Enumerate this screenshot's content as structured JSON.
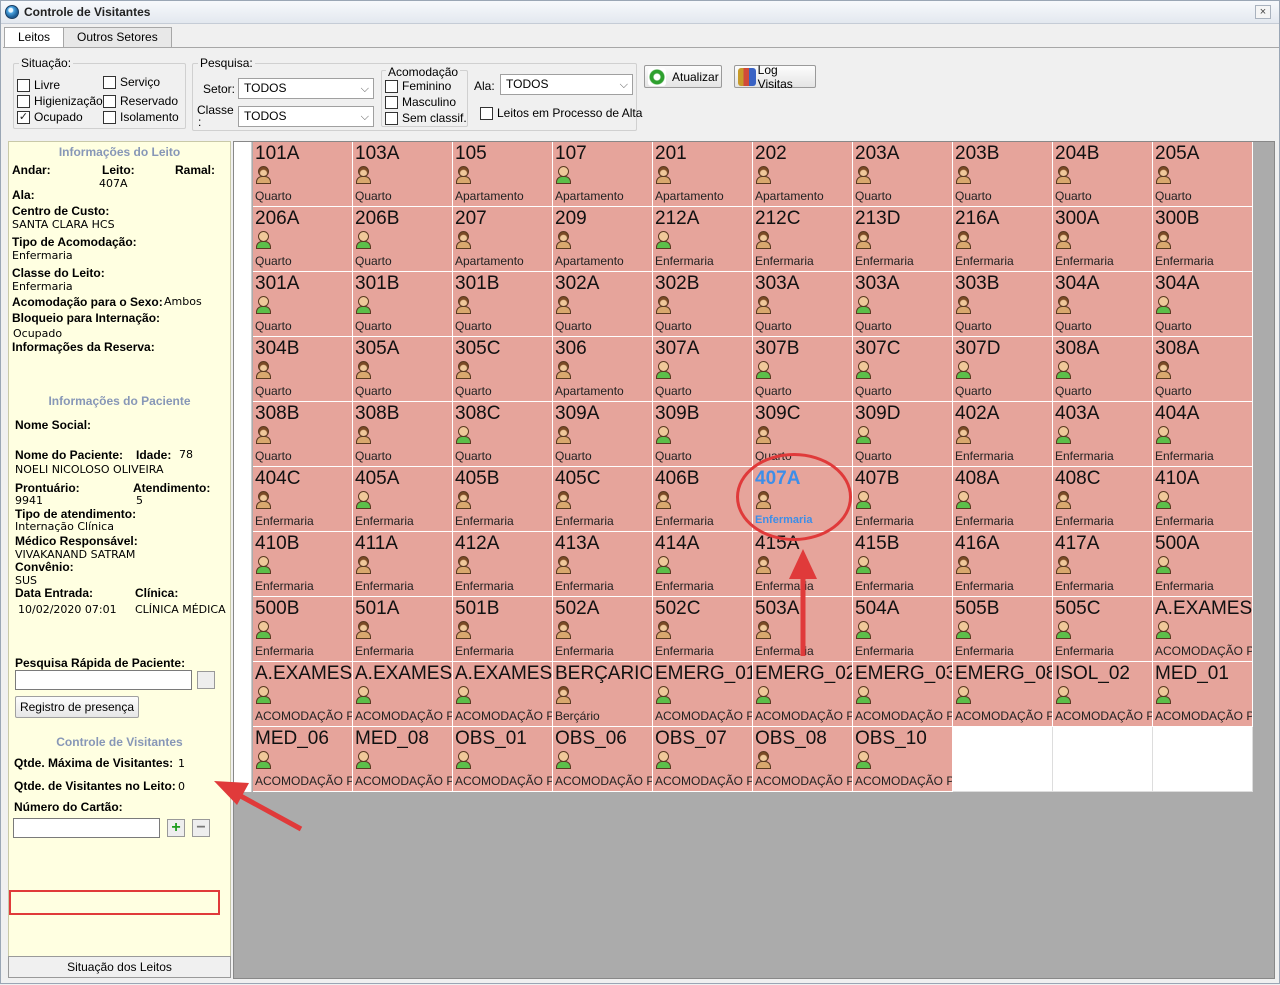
{
  "window": {
    "title": "Controle de Visitantes",
    "close_label": "×"
  },
  "tabs": [
    {
      "label": "Leitos",
      "active": true
    },
    {
      "label": "Outros Setores",
      "active": false
    }
  ],
  "situacao": {
    "legend": "Situação:",
    "options": [
      {
        "label": "Livre",
        "checked": false
      },
      {
        "label": "Serviço",
        "checked": false
      },
      {
        "label": "Higienização",
        "checked": false
      },
      {
        "label": "Reservado",
        "checked": false
      },
      {
        "label": "Ocupado",
        "checked": true
      },
      {
        "label": "Isolamento",
        "checked": false
      }
    ]
  },
  "pesquisa": {
    "legend": "Pesquisa:",
    "setor_label": "Setor:",
    "setor_value": "TODOS",
    "classe_label": "Classe",
    "classe_label2": ":",
    "classe_value": "TODOS"
  },
  "acomodacao": {
    "legend": "Acomodação",
    "options": [
      {
        "label": "Feminino",
        "checked": false
      },
      {
        "label": "Masculino",
        "checked": false
      },
      {
        "label": "Sem classif.",
        "checked": false
      }
    ]
  },
  "ala": {
    "label": "Ala:",
    "value": "TODOS"
  },
  "processo_alta": {
    "label": "Leitos em Processo de Alta",
    "checked": false
  },
  "toolbar": {
    "atualizar_label": "Atualizar",
    "log_label": "Log Visitas"
  },
  "leito_info": {
    "heading": "Informações do Leito",
    "andar_label": "Andar:",
    "leito_label": "Leito:",
    "leito_value": "407A",
    "ramal_label": "Ramal:",
    "ala_label": "Ala:",
    "centro_custo_label": "Centro de Custo:",
    "centro_custo_value": "SANTA CLARA HCS",
    "tipo_acomodacao_label": "Tipo de Acomodação:",
    "tipo_acomodacao_value": "Enfermaria",
    "classe_leito_label": "Classe do Leito:",
    "classe_leito_value": "Enfermaria",
    "sexo_label": "Acomodação para o Sexo:",
    "sexo_value": "Ambos",
    "bloqueio_label": "Bloqueio para Internação:",
    "bloqueio_value": "Ocupado",
    "reserva_label": "Informações da Reserva:"
  },
  "paciente_info": {
    "heading": "Informações do Paciente",
    "nome_social_label": "Nome Social:",
    "nome_label": "Nome do Paciente:",
    "idade_label": "Idade:",
    "idade_value": "78",
    "nome_value": "NOELI NICOLOSO OLIVEIRA",
    "prontuario_label": "Prontuário:",
    "prontuario_value": "9941",
    "atendimento_label": "Atendimento:",
    "atendimento_value": "5",
    "tipo_atendimento_label": "Tipo de atendimento:",
    "tipo_atendimento_value": "Internação Clínica",
    "medico_label": "Médico Responsável:",
    "medico_value": "VIVAKANAND SATRAM",
    "convenio_label": "Convênio:",
    "convenio_value": "SUS",
    "data_entrada_label": "Data Entrada:",
    "data_entrada_value": "10/02/2020 07:01",
    "clinica_label": "Clínica:",
    "clinica_value": "CLÍNICA MÉDICA"
  },
  "pesquisa_rapida": {
    "label": "Pesquisa Rápida de Paciente:",
    "button_label": "Registro de presença"
  },
  "visitantes": {
    "heading": "Controle de Visitantes",
    "max_label": "Qtde. Máxima de Visitantes:",
    "max_value": "1",
    "no_leito_label": "Qtde. de Visitantes no Leito:",
    "no_leito_value": "0",
    "cartao_label": "Número do Cartão:"
  },
  "status_button": "Situação dos Leitos",
  "beds": [
    {
      "n": "101A",
      "t": "Quarto",
      "g": "f"
    },
    {
      "n": "103A",
      "t": "Quarto",
      "g": "f"
    },
    {
      "n": "105",
      "t": "Apartamento",
      "g": "f"
    },
    {
      "n": "107",
      "t": "Apartamento",
      "g": "m"
    },
    {
      "n": "201",
      "t": "Apartamento",
      "g": "f"
    },
    {
      "n": "202",
      "t": "Apartamento",
      "g": "f"
    },
    {
      "n": "203A",
      "t": "Quarto",
      "g": "f"
    },
    {
      "n": "203B",
      "t": "Quarto",
      "g": "f"
    },
    {
      "n": "204B",
      "t": "Quarto",
      "g": "f"
    },
    {
      "n": "205A",
      "t": "Quarto",
      "g": "f"
    },
    {
      "n": "206A",
      "t": "Quarto",
      "g": "m"
    },
    {
      "n": "206B",
      "t": "Quarto",
      "g": "m"
    },
    {
      "n": "207",
      "t": "Apartamento",
      "g": "f"
    },
    {
      "n": "209",
      "t": "Apartamento",
      "g": "f"
    },
    {
      "n": "212A",
      "t": "Enfermaria",
      "g": "m"
    },
    {
      "n": "212C",
      "t": "Enfermaria",
      "g": "f"
    },
    {
      "n": "213D",
      "t": "Enfermaria",
      "g": "f"
    },
    {
      "n": "216A",
      "t": "Enfermaria",
      "g": "f"
    },
    {
      "n": "300A",
      "t": "Enfermaria",
      "g": "f"
    },
    {
      "n": "300B",
      "t": "Enfermaria",
      "g": "f"
    },
    {
      "n": "301A",
      "t": "Quarto",
      "g": "m"
    },
    {
      "n": "301B",
      "t": "Quarto",
      "g": "m"
    },
    {
      "n": "301B",
      "t": "Quarto",
      "g": "f"
    },
    {
      "n": "302A",
      "t": "Quarto",
      "g": "f"
    },
    {
      "n": "302B",
      "t": "Quarto",
      "g": "f"
    },
    {
      "n": "303A",
      "t": "Quarto",
      "g": "f"
    },
    {
      "n": "303A",
      "t": "Quarto",
      "g": "m"
    },
    {
      "n": "303B",
      "t": "Quarto",
      "g": "f"
    },
    {
      "n": "304A",
      "t": "Quarto",
      "g": "f"
    },
    {
      "n": "304A",
      "t": "Quarto",
      "g": "m"
    },
    {
      "n": "304B",
      "t": "Quarto",
      "g": "f"
    },
    {
      "n": "305A",
      "t": "Quarto",
      "g": "f"
    },
    {
      "n": "305C",
      "t": "Quarto",
      "g": "f"
    },
    {
      "n": "306",
      "t": "Apartamento",
      "g": "f"
    },
    {
      "n": "307A",
      "t": "Quarto",
      "g": "m"
    },
    {
      "n": "307B",
      "t": "Quarto",
      "g": "m"
    },
    {
      "n": "307C",
      "t": "Quarto",
      "g": "m"
    },
    {
      "n": "307D",
      "t": "Quarto",
      "g": "m"
    },
    {
      "n": "308A",
      "t": "Quarto",
      "g": "m"
    },
    {
      "n": "308A",
      "t": "Quarto",
      "g": "f"
    },
    {
      "n": "308B",
      "t": "Quarto",
      "g": "f"
    },
    {
      "n": "308B",
      "t": "Quarto",
      "g": "f"
    },
    {
      "n": "308C",
      "t": "Quarto",
      "g": "m"
    },
    {
      "n": "309A",
      "t": "Quarto",
      "g": "f"
    },
    {
      "n": "309B",
      "t": "Quarto",
      "g": "m"
    },
    {
      "n": "309C",
      "t": "Quarto",
      "g": "f"
    },
    {
      "n": "309D",
      "t": "Quarto",
      "g": "m"
    },
    {
      "n": "402A",
      "t": "Enfermaria",
      "g": "f"
    },
    {
      "n": "403A",
      "t": "Enfermaria",
      "g": "m"
    },
    {
      "n": "404A",
      "t": "Enfermaria",
      "g": "m"
    },
    {
      "n": "404C",
      "t": "Enfermaria",
      "g": "f"
    },
    {
      "n": "405A",
      "t": "Enfermaria",
      "g": "m"
    },
    {
      "n": "405B",
      "t": "Enfermaria",
      "g": "f"
    },
    {
      "n": "405C",
      "t": "Enfermaria",
      "g": "f"
    },
    {
      "n": "406B",
      "t": "Enfermaria",
      "g": "f"
    },
    {
      "n": "407A",
      "t": "Enfermaria",
      "g": "f",
      "sel": true
    },
    {
      "n": "407B",
      "t": "Enfermaria",
      "g": "m"
    },
    {
      "n": "408A",
      "t": "Enfermaria",
      "g": "m"
    },
    {
      "n": "408C",
      "t": "Enfermaria",
      "g": "f"
    },
    {
      "n": "410A",
      "t": "Enfermaria",
      "g": "m"
    },
    {
      "n": "410B",
      "t": "Enfermaria",
      "g": "m"
    },
    {
      "n": "411A",
      "t": "Enfermaria",
      "g": "f"
    },
    {
      "n": "412A",
      "t": "Enfermaria",
      "g": "f"
    },
    {
      "n": "413A",
      "t": "Enfermaria",
      "g": "f"
    },
    {
      "n": "414A",
      "t": "Enfermaria",
      "g": "m"
    },
    {
      "n": "415A",
      "t": "Enfermaria",
      "g": "f"
    },
    {
      "n": "415B",
      "t": "Enfermaria",
      "g": "m"
    },
    {
      "n": "416A",
      "t": "Enfermaria",
      "g": "f"
    },
    {
      "n": "417A",
      "t": "Enfermaria",
      "g": "f"
    },
    {
      "n": "500A",
      "t": "Enfermaria",
      "g": "m"
    },
    {
      "n": "500B",
      "t": "Enfermaria",
      "g": "m"
    },
    {
      "n": "501A",
      "t": "Enfermaria",
      "g": "f"
    },
    {
      "n": "501B",
      "t": "Enfermaria",
      "g": "f"
    },
    {
      "n": "502A",
      "t": "Enfermaria",
      "g": "f"
    },
    {
      "n": "502C",
      "t": "Enfermaria",
      "g": "f"
    },
    {
      "n": "503A",
      "t": "Enfermaria",
      "g": "f"
    },
    {
      "n": "504A",
      "t": "Enfermaria",
      "g": "m"
    },
    {
      "n": "505B",
      "t": "Enfermaria",
      "g": "m"
    },
    {
      "n": "505C",
      "t": "Enfermaria",
      "g": "m"
    },
    {
      "n": "A.EXAMES",
      "t": "ACOMODAÇÃO P",
      "g": "m"
    },
    {
      "n": "A.EXAMES",
      "t": "ACOMODAÇÃO P",
      "g": "m"
    },
    {
      "n": "A.EXAMES",
      "t": "ACOMODAÇÃO P",
      "g": "m"
    },
    {
      "n": "A.EXAMES",
      "t": "ACOMODAÇÃO P",
      "g": "m"
    },
    {
      "n": "BERÇARIO",
      "t": "Berçário",
      "g": "f"
    },
    {
      "n": "EMERG_01",
      "t": "ACOMODAÇÃO P",
      "g": "m"
    },
    {
      "n": "EMERG_02",
      "t": "ACOMODAÇÃO P",
      "g": "m"
    },
    {
      "n": "EMERG_03",
      "t": "ACOMODAÇÃO P",
      "g": "m"
    },
    {
      "n": "EMERG_08",
      "t": "ACOMODAÇÃO P",
      "g": "m"
    },
    {
      "n": "ISOL_02",
      "t": "ACOMODAÇÃO P",
      "g": "m"
    },
    {
      "n": "MED_01",
      "t": "ACOMODAÇÃO P",
      "g": "m"
    },
    {
      "n": "MED_06",
      "t": "ACOMODAÇÃO P",
      "g": "m"
    },
    {
      "n": "MED_08",
      "t": "ACOMODAÇÃO P",
      "g": "m"
    },
    {
      "n": "OBS_01",
      "t": "ACOMODAÇÃO P",
      "g": "m"
    },
    {
      "n": "OBS_06",
      "t": "ACOMODAÇÃO P",
      "g": "m"
    },
    {
      "n": "OBS_07",
      "t": "ACOMODAÇÃO P",
      "g": "m"
    },
    {
      "n": "OBS_08",
      "t": "ACOMODAÇÃO P",
      "g": "f"
    },
    {
      "n": "OBS_10",
      "t": "ACOMODAÇÃO P",
      "g": "m"
    },
    {
      "n": "",
      "t": "",
      "g": "",
      "empty": true
    },
    {
      "n": "",
      "t": "",
      "g": "",
      "empty": true
    },
    {
      "n": "",
      "t": "",
      "g": "",
      "empty": true
    }
  ],
  "colors": {
    "occupied": "#e6a49b",
    "selected_text": "#3d8ee8",
    "annotation": "#e03a3a",
    "panel": "#ffffe1"
  }
}
